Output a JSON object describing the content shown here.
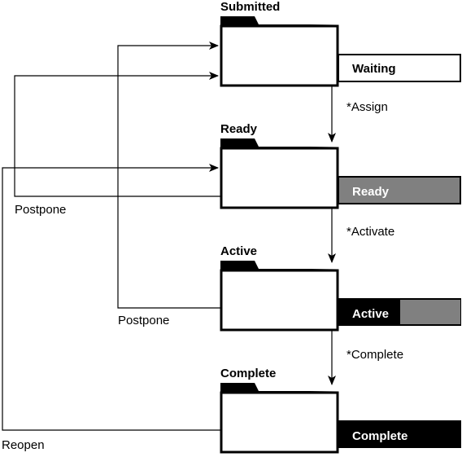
{
  "states": [
    {
      "title": "Submitted",
      "status": "Waiting"
    },
    {
      "title": "Ready",
      "status": "Ready"
    },
    {
      "title": "Active",
      "status": "Active"
    },
    {
      "title": "Complete",
      "status": "Complete"
    }
  ],
  "transitions": {
    "assign": "*Assign",
    "activate": "*Activate",
    "complete": "*Complete",
    "postpone_from_ready": "Postpone",
    "postpone_from_active": "Postpone",
    "reopen": "Reopen"
  },
  "colors": {
    "gray": "#808080",
    "black": "#000000",
    "white": "#ffffff"
  }
}
